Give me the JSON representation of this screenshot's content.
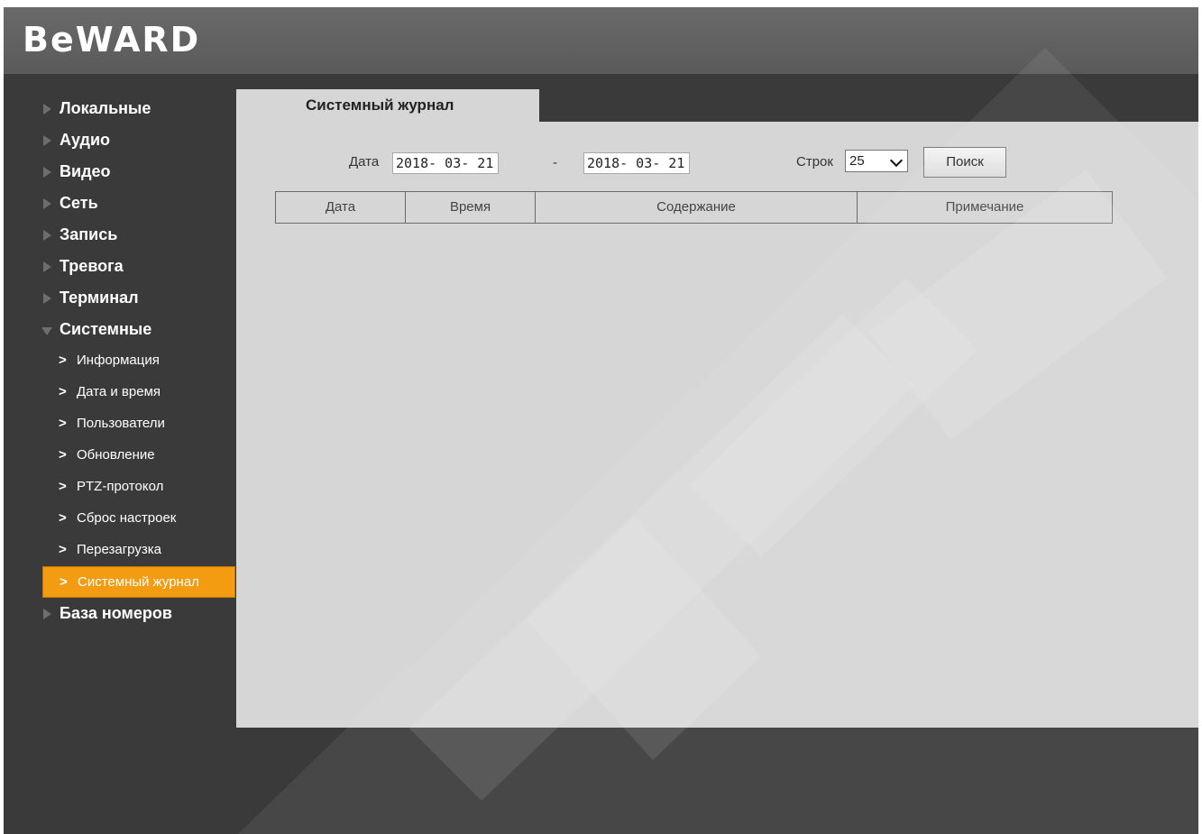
{
  "brand": {
    "logo_text": "BeWARD"
  },
  "sidebar": {
    "items": [
      {
        "label": "Локальные",
        "expanded": false
      },
      {
        "label": "Аудио",
        "expanded": false
      },
      {
        "label": "Видео",
        "expanded": false
      },
      {
        "label": "Сеть",
        "expanded": false
      },
      {
        "label": "Запись",
        "expanded": false
      },
      {
        "label": "Тревога",
        "expanded": false
      },
      {
        "label": "Терминал",
        "expanded": false
      },
      {
        "label": "Системные",
        "expanded": true
      },
      {
        "label": "База номеров",
        "expanded": false
      }
    ],
    "subitems": [
      {
        "label": "Информация"
      },
      {
        "label": "Дата и время"
      },
      {
        "label": "Пользователи"
      },
      {
        "label": "Обновление"
      },
      {
        "label": "PTZ-протокол"
      },
      {
        "label": "Сброс настроек"
      },
      {
        "label": "Перезагрузка"
      },
      {
        "label": "Системный журнал",
        "active": true
      }
    ],
    "chevron": ">"
  },
  "tab": {
    "label": "Системный журнал"
  },
  "filter": {
    "date_label": "Дата",
    "date_from": "2018- 03- 21",
    "separator": "-",
    "date_to": "2018- 03- 21",
    "rows_label": "Строк",
    "rows_value": "25",
    "search_label": "Поиск"
  },
  "table": {
    "headers": [
      "Дата",
      "Время",
      "Содержание",
      "Примечание"
    ],
    "rows": []
  },
  "colors": {
    "active_item": "#f39c12",
    "content_bg": "#d6d6d6",
    "frame_bg": "#3a3a3a",
    "header_bg": "#5f5f5f"
  },
  "icons": {
    "collapsed": "triangle-right-icon",
    "expanded": "triangle-down-icon",
    "sub": "chevron-right-icon",
    "dropdown": "chevron-down-icon"
  }
}
